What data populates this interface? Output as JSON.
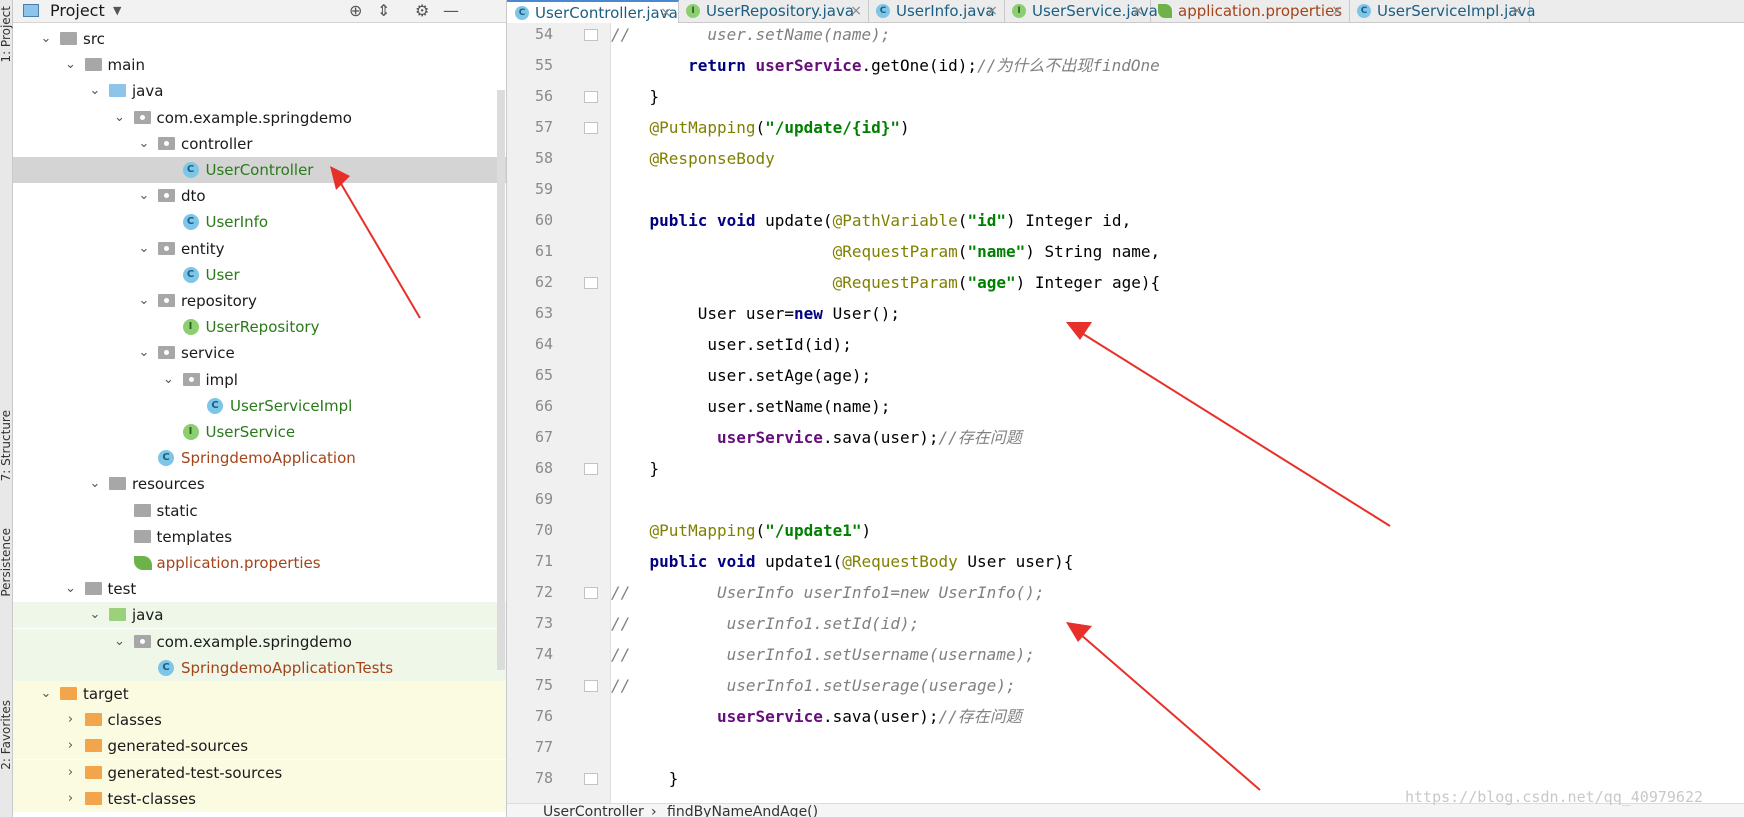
{
  "toolstrip": {
    "project_tab": "1: Project",
    "structure_tab": "7: Structure",
    "persistence_tab": "Persistence",
    "favorites_tab": "2: Favorites"
  },
  "project_panel": {
    "title": "Project",
    "dropdown_icon": "chevron-down-icon",
    "header_icons": [
      "target-icon",
      "collapse-icon",
      "gear-icon",
      "minimize-icon"
    ]
  },
  "tree": [
    {
      "label": "src",
      "depth": 0,
      "expanded": true,
      "icon": "folder-gray"
    },
    {
      "label": "main",
      "depth": 1,
      "expanded": true,
      "icon": "folder-gray"
    },
    {
      "label": "java",
      "depth": 2,
      "expanded": true,
      "icon": "folder-blue"
    },
    {
      "label": "com.example.springdemo",
      "depth": 3,
      "expanded": true,
      "icon": "package"
    },
    {
      "label": "controller",
      "depth": 4,
      "expanded": true,
      "icon": "package"
    },
    {
      "label": "UserController",
      "depth": 5,
      "icon": "class",
      "selected": true,
      "color": "green"
    },
    {
      "label": "dto",
      "depth": 4,
      "expanded": true,
      "icon": "package"
    },
    {
      "label": "UserInfo",
      "depth": 5,
      "icon": "class",
      "color": "green"
    },
    {
      "label": "entity",
      "depth": 4,
      "expanded": true,
      "icon": "package"
    },
    {
      "label": "User",
      "depth": 5,
      "icon": "class",
      "color": "green"
    },
    {
      "label": "repository",
      "depth": 4,
      "expanded": true,
      "icon": "package"
    },
    {
      "label": "UserRepository",
      "depth": 5,
      "icon": "interface",
      "color": "green"
    },
    {
      "label": "service",
      "depth": 4,
      "expanded": true,
      "icon": "package"
    },
    {
      "label": "impl",
      "depth": 5,
      "expanded": true,
      "icon": "package"
    },
    {
      "label": "UserServiceImpl",
      "depth": 6,
      "icon": "class",
      "color": "green"
    },
    {
      "label": "UserService",
      "depth": 5,
      "icon": "interface",
      "color": "green"
    },
    {
      "label": "SpringdemoApplication",
      "depth": 4,
      "icon": "spring-class",
      "color": "brown"
    },
    {
      "label": "resources",
      "depth": 2,
      "expanded": true,
      "icon": "folder-resources"
    },
    {
      "label": "static",
      "depth": 3,
      "icon": "folder-gray"
    },
    {
      "label": "templates",
      "depth": 3,
      "icon": "folder-gray"
    },
    {
      "label": "application.properties",
      "depth": 3,
      "icon": "properties",
      "color": "brown"
    },
    {
      "label": "test",
      "depth": 1,
      "expanded": true,
      "icon": "folder-gray"
    },
    {
      "label": "java",
      "depth": 2,
      "expanded": true,
      "icon": "folder-green",
      "bg": "test"
    },
    {
      "label": "com.example.springdemo",
      "depth": 3,
      "expanded": true,
      "icon": "package",
      "bg": "test"
    },
    {
      "label": "SpringdemoApplicationTests",
      "depth": 4,
      "icon": "spring-class",
      "color": "brown",
      "bg": "test"
    },
    {
      "label": "target",
      "depth": 0,
      "expanded": true,
      "icon": "folder-orange",
      "bg": "target"
    },
    {
      "label": "classes",
      "depth": 1,
      "expanded": false,
      "icon": "folder-orange",
      "bg": "target"
    },
    {
      "label": "generated-sources",
      "depth": 1,
      "expanded": false,
      "icon": "folder-orange",
      "bg": "target"
    },
    {
      "label": "generated-test-sources",
      "depth": 1,
      "expanded": false,
      "icon": "folder-orange",
      "bg": "target"
    },
    {
      "label": "test-classes",
      "depth": 1,
      "expanded": false,
      "icon": "folder-orange",
      "bg": "target"
    }
  ],
  "tabs": [
    {
      "name": "UserController.java",
      "icon": "class",
      "active": true
    },
    {
      "name": "UserRepository.java",
      "icon": "interface"
    },
    {
      "name": "UserInfo.java",
      "icon": "class"
    },
    {
      "name": "UserService.java",
      "icon": "interface"
    },
    {
      "name": "application.properties",
      "icon": "properties"
    },
    {
      "name": "UserServiceImpl.java",
      "icon": "class"
    }
  ],
  "close_glyph": "×",
  "code_lines": [
    {
      "n": "54",
      "parts": [
        [
          "cm",
          "//        user.setName(name);"
        ]
      ]
    },
    {
      "n": "55",
      "parts": [
        [
          "",
          "        "
        ],
        [
          "kw",
          "return "
        ],
        [
          "fld",
          "userService"
        ],
        [
          "",
          ".getOne(id);"
        ],
        [
          "cm",
          "//为什么不出现findOne"
        ]
      ]
    },
    {
      "n": "56",
      "parts": [
        [
          "",
          "    }"
        ]
      ]
    },
    {
      "n": "57",
      "parts": [
        [
          "",
          "    "
        ],
        [
          "ann",
          "@PutMapping"
        ],
        [
          "",
          "("
        ],
        [
          "str",
          "\"/update/{id}\""
        ],
        [
          "",
          ")"
        ]
      ]
    },
    {
      "n": "58",
      "parts": [
        [
          "",
          "    "
        ],
        [
          "ann",
          "@ResponseBody"
        ]
      ]
    },
    {
      "n": "59",
      "parts": [
        [
          "",
          ""
        ]
      ]
    },
    {
      "n": "60",
      "parts": [
        [
          "",
          "    "
        ],
        [
          "kw",
          "public void "
        ],
        [
          "",
          "update("
        ],
        [
          "ann",
          "@PathVariable"
        ],
        [
          "",
          "("
        ],
        [
          "str",
          "\"id\""
        ],
        [
          "",
          ") Integer id,"
        ]
      ]
    },
    {
      "n": "61",
      "parts": [
        [
          "",
          "                       "
        ],
        [
          "ann",
          "@RequestParam"
        ],
        [
          "",
          "("
        ],
        [
          "str",
          "\"name\""
        ],
        [
          "",
          ") String name,"
        ]
      ]
    },
    {
      "n": "62",
      "parts": [
        [
          "",
          "                       "
        ],
        [
          "ann",
          "@RequestParam"
        ],
        [
          "",
          "("
        ],
        [
          "str",
          "\"age\""
        ],
        [
          "",
          ") Integer age){"
        ]
      ]
    },
    {
      "n": "63",
      "parts": [
        [
          "",
          "         User user="
        ],
        [
          "kw",
          "new "
        ],
        [
          "",
          "User();"
        ]
      ]
    },
    {
      "n": "64",
      "parts": [
        [
          "",
          "          user.setId(id);"
        ]
      ]
    },
    {
      "n": "65",
      "parts": [
        [
          "",
          "          user.setAge(age);"
        ]
      ]
    },
    {
      "n": "66",
      "parts": [
        [
          "",
          "          user.setName(name);"
        ]
      ]
    },
    {
      "n": "67",
      "parts": [
        [
          "",
          "           "
        ],
        [
          "fld",
          "userService"
        ],
        [
          "",
          ".sava(user);"
        ],
        [
          "cm",
          "//存在问题"
        ]
      ]
    },
    {
      "n": "68",
      "parts": [
        [
          "",
          "    }"
        ]
      ]
    },
    {
      "n": "69",
      "parts": [
        [
          "",
          ""
        ]
      ]
    },
    {
      "n": "70",
      "parts": [
        [
          "",
          "    "
        ],
        [
          "ann",
          "@PutMapping"
        ],
        [
          "",
          "("
        ],
        [
          "str",
          "\"/update1\""
        ],
        [
          "",
          ")"
        ]
      ]
    },
    {
      "n": "71",
      "parts": [
        [
          "",
          "    "
        ],
        [
          "kw",
          "public void "
        ],
        [
          "",
          "update1("
        ],
        [
          "ann",
          "@RequestBody "
        ],
        [
          "",
          "User user){"
        ]
      ]
    },
    {
      "n": "72",
      "parts": [
        [
          "cm",
          "//         UserInfo userInfo1=new UserInfo();"
        ]
      ]
    },
    {
      "n": "73",
      "parts": [
        [
          "cm",
          "//          userInfo1.setId(id);"
        ]
      ]
    },
    {
      "n": "74",
      "parts": [
        [
          "cm",
          "//          userInfo1.setUsername(username);"
        ]
      ]
    },
    {
      "n": "75",
      "parts": [
        [
          "cm",
          "//          userInfo1.setUserage(userage);"
        ]
      ]
    },
    {
      "n": "76",
      "parts": [
        [
          "",
          "           "
        ],
        [
          "fld",
          "userService"
        ],
        [
          "",
          ".sava(user);"
        ],
        [
          "cm",
          "//存在问题"
        ]
      ]
    },
    {
      "n": "77",
      "parts": [
        [
          "",
          ""
        ]
      ]
    },
    {
      "n": "78",
      "parts": [
        [
          "",
          "      }"
        ]
      ]
    }
  ],
  "breadcrumb": {
    "class_name": "UserController",
    "separator": "›",
    "method_name": "findByNameAndAge()"
  },
  "watermark": "https://blog.csdn.net/qq_40979622",
  "colors": {
    "arrow": "#e8302a",
    "selection": "#d4d4d4",
    "active_tab_border": "#4a88d0"
  }
}
